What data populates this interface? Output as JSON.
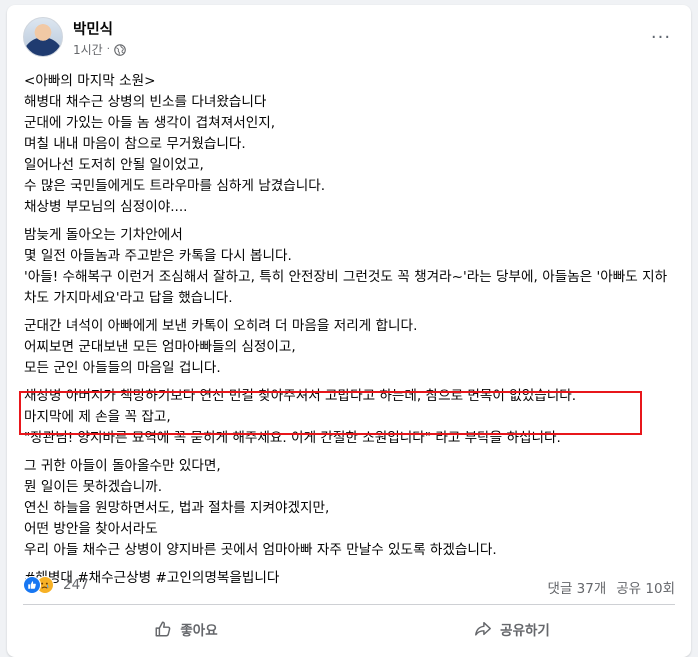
{
  "post": {
    "author": "박민식",
    "time": "1시간",
    "separator": "·",
    "more_label": "···",
    "paragraphs": [
      [
        "<아빠의 마지막 소원>",
        "해병대 채수근 상병의 빈소를 다녀왔습니다",
        "군대에 가있는 아들 놈 생각이 겹쳐져서인지,",
        "며칠 내내 마음이 참으로 무거웠습니다.",
        "일어나선 도저히 안될 일이었고,",
        "수 많은 국민들에게도 트라우마를 심하게 남겼습니다.",
        "채상병 부모님의 심정이야...."
      ],
      [
        "밤늦게 돌아오는 기차안에서",
        "몇 일전 아들놈과 주고받은 카톡을 다시 봅니다.",
        "'아들! 수해복구 이런거 조심해서 잘하고, 특히 안전장비 그런것도 꼭 챙겨라~'라는 당부에, 아들놈은 '아빠도 지하차도 가지마세요'라고 답을 했습니다."
      ],
      [
        "군대간 녀석이 아빠에게 보낸 카톡이 오히려 더 마음을 저리게 합니다.",
        "어찌보면 군대보낸 모든 엄마아빠들의 심정이고,",
        "모든 군인 아들들의 마음일 겁니다."
      ],
      [
        "채상병 아버지가 책망하기보다 연신 먼길 찾아주셔서 고맙다고 하는데, 참으로 면목이 없었습니다.",
        "마지막에 제 손을 꼭 잡고,",
        "\"장관님! 양지바른 묘역에 꼭 묻히게 해주세요. 이게 간절한 소원입니다\" 라고 부탁을 하십니다."
      ],
      [
        "그 귀한 아들이 돌아올수만 있다면,",
        "뭔 일이든 못하겠습니까.",
        "연신 하늘을 원망하면서도, 법과 절차를 지켜야겠지만,",
        "어떤 방안을 찾아서라도",
        "우리 아들 채수근 상병이 양지바른 곳에서 엄마아빠 자주 만날수 있도록 하겠습니다."
      ],
      [
        "#해병대 #채수근상병 #고인의명복을빕니다"
      ]
    ]
  },
  "stats": {
    "reaction_count": "247",
    "comments": "댓글 37개",
    "shares": "공유 10회"
  },
  "actions": {
    "like_label": "좋아요",
    "share_label": "공유하기"
  },
  "colors": {
    "highlight": "#e8161b",
    "like": "#1877f2",
    "sad": "#f7b125"
  }
}
